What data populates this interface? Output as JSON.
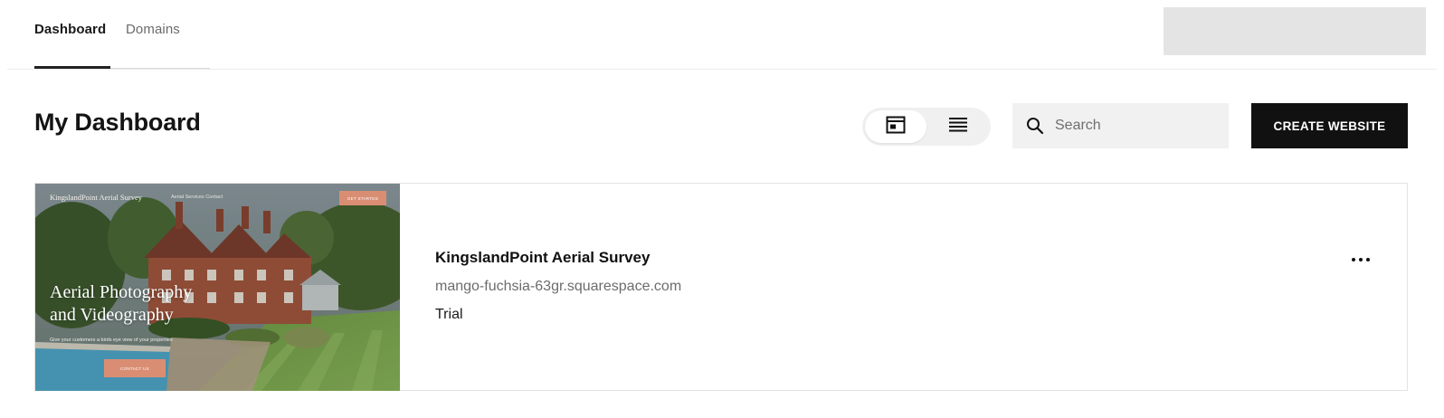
{
  "nav": {
    "tabs": [
      {
        "label": "Dashboard",
        "active": true
      },
      {
        "label": "Domains",
        "active": false
      }
    ]
  },
  "header": {
    "title": "My Dashboard",
    "view_toggle": {
      "options": [
        "grid-view-icon",
        "list-view-icon"
      ],
      "selected": "grid-view-icon"
    },
    "search": {
      "placeholder": "Search",
      "value": ""
    },
    "create_label": "CREATE WEBSITE"
  },
  "sites": [
    {
      "name": "KingslandPoint Aerial Survey",
      "url": "mango-fuchsia-63gr.squarespace.com",
      "status": "Trial",
      "thumbnail": {
        "nav_title": "KingslandPoint Aerial Survey",
        "nav_links": "Aerial Services   Contact",
        "nav_cta": "GET STARTED",
        "heading_line1": "Aerial Photography",
        "heading_line2": "and Videography",
        "subtitle": "Give your customers a birds eye view of your properties",
        "button": "CONTACT US"
      }
    }
  ],
  "colors": {
    "accent_button": "#111111",
    "thumb_cta": "#d98e73",
    "search_bg": "#f1f1f1"
  }
}
